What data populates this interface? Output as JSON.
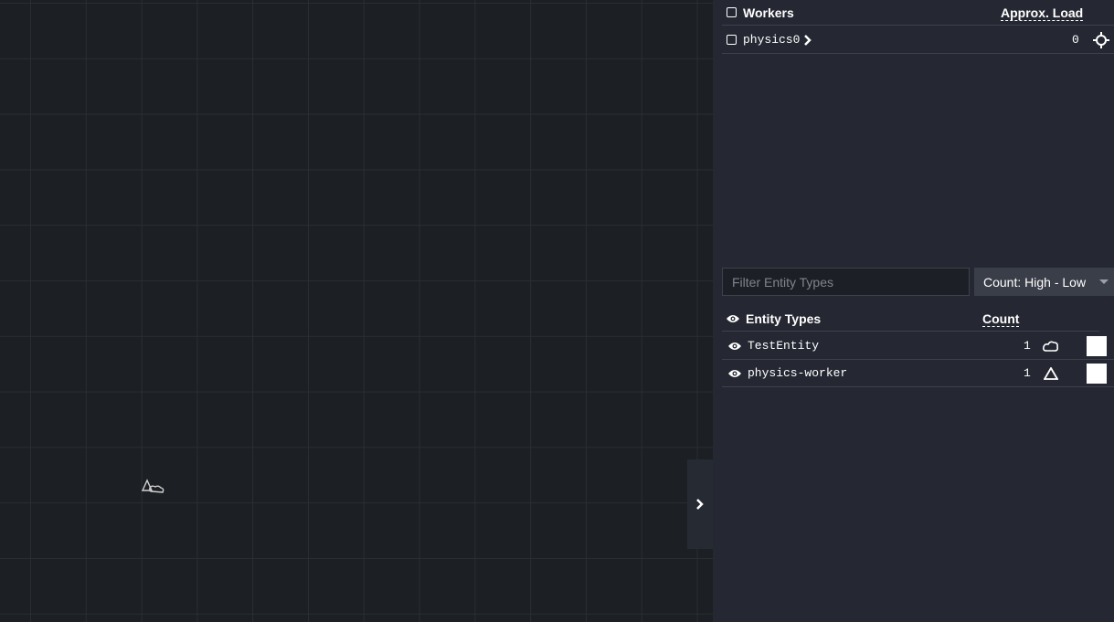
{
  "workers": {
    "header_label": "Workers",
    "load_header": "Approx. Load",
    "items": [
      {
        "name": "physics0",
        "load": "0"
      }
    ]
  },
  "entity_filter": {
    "placeholder": "Filter Entity Types",
    "sort_value": "Count: High - Low"
  },
  "entity_types": {
    "header_label": "Entity Types",
    "count_header": "Count",
    "items": [
      {
        "name": "TestEntity",
        "count": "1",
        "shape_icon": "cloud-icon",
        "color": "#ffffff"
      },
      {
        "name": "physics-worker",
        "count": "1",
        "shape_icon": "triangle-icon",
        "color": "#ffffff"
      }
    ]
  },
  "colors": {
    "canvas_bg": "#1c1f23",
    "grid_line": "#2a2e33",
    "panel_bg": "#252832",
    "divider": "#3d414c"
  }
}
